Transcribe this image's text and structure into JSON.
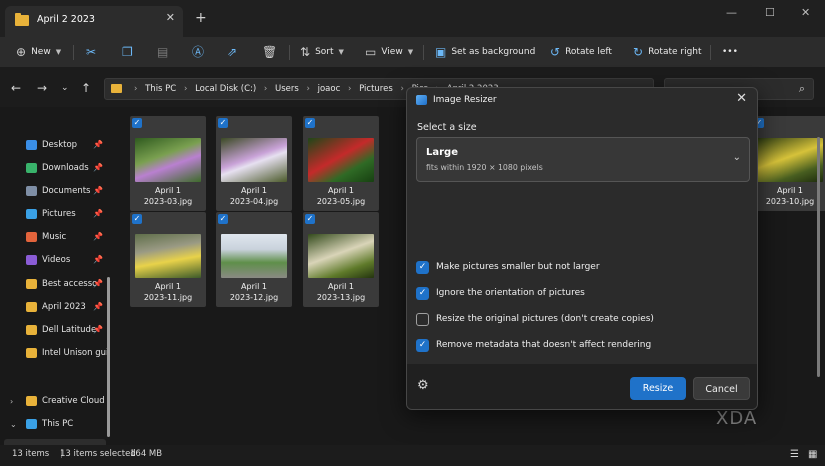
{
  "window": {
    "tab_title": "April 2 2023",
    "new_tab_glyph": "+",
    "minimize_glyph": "—",
    "maximize_glyph": "☐",
    "close_glyph": "✕"
  },
  "toolbar": {
    "new_label": "New",
    "sort_label": "Sort",
    "view_label": "View",
    "set_background_label": "Set as background",
    "rotate_left_label": "Rotate left",
    "rotate_right_label": "Rotate right",
    "more_glyph": "•••"
  },
  "address": {
    "crumbs": [
      "This PC",
      "Local Disk (C:)",
      "Users",
      "joaoc",
      "Pictures",
      "Pics",
      "April 2 2023"
    ]
  },
  "sidebar": {
    "items": [
      {
        "label": "Desktop",
        "icon": "desktop-icon",
        "color": "#3a8ee6",
        "pinned": true
      },
      {
        "label": "Downloads",
        "icon": "download-icon",
        "color": "#39b36b",
        "pinned": true
      },
      {
        "label": "Documents",
        "icon": "document-icon",
        "color": "#7f8fa6",
        "pinned": true
      },
      {
        "label": "Pictures",
        "icon": "pictures-icon",
        "color": "#3aa1e6",
        "pinned": true
      },
      {
        "label": "Music",
        "icon": "music-icon",
        "color": "#e3643c",
        "pinned": true
      },
      {
        "label": "Videos",
        "icon": "videos-icon",
        "color": "#8b5cd6",
        "pinned": true
      },
      {
        "label": "Best accessor",
        "icon": "folder-icon",
        "color": "#e8b23a",
        "pinned": true
      },
      {
        "label": "April 2023",
        "icon": "folder-icon",
        "color": "#e8b23a",
        "pinned": true
      },
      {
        "label": "Dell Latitude",
        "icon": "folder-icon",
        "color": "#e8b23a",
        "pinned": true
      },
      {
        "label": "Intel Unison gui",
        "icon": "folder-icon",
        "color": "#e8b23a",
        "pinned": false
      },
      {
        "label": "Creative Cloud F",
        "icon": "creative-cloud-icon",
        "color": "#e8b23a",
        "pinned": false
      },
      {
        "label": "This PC",
        "icon": "this-pc-icon",
        "color": "#3aa1e6",
        "pinned": false
      }
    ]
  },
  "files": [
    {
      "line1": "April 1",
      "line2": "2023-03.jpg",
      "bg": "linear-gradient(160deg,#2f5a1f 0%,#7aa050 40%,#b980d0 60%,#3d6b2a 100%)"
    },
    {
      "line1": "April 1",
      "line2": "2023-04.jpg",
      "bg": "linear-gradient(160deg,#3b4a24 0%,#c9a3d8 45%,#e6e0f0 55%,#4b5a2a 100%)"
    },
    {
      "line1": "April 1",
      "line2": "2023-05.jpg",
      "bg": "linear-gradient(150deg,#1e4718 0%,#c42a2a 45%,#2f6a25 70%,#174011 100%)"
    },
    {
      "line1": "April 1",
      "line2": "2023-10.jpg",
      "bg": "linear-gradient(160deg,#2a3a12 0%,#d6c23a 45%,#485e20 75%,#1d2b0c 100%)"
    },
    {
      "line1": "April 1",
      "line2": "2023-11.jpg",
      "bg": "linear-gradient(170deg,#5f6e4a 0%,#9a9a84 35%,#e8d24a 60%,#3d5a2a 100%)"
    },
    {
      "line1": "April 1",
      "line2": "2023-12.jpg",
      "bg": "linear-gradient(180deg,#dfe6ee 0%,#c9d2dc 35%,#5f8f4a 65%,#8a8a84 100%)"
    },
    {
      "line1": "April 1",
      "line2": "2023-13.jpg",
      "bg": "linear-gradient(160deg,#334a1c 0%,#d9d4b8 45%,#5f7a2a 75%,#24340f 100%)"
    }
  ],
  "status": {
    "items_count": "13 items",
    "selected": "13 items selected",
    "size": "164 MB"
  },
  "watermark": "XDA",
  "dialog": {
    "title": "Image Resizer",
    "size_label": "Select a size",
    "size_name": "Large",
    "size_desc": "fits within 1920 × 1080 pixels",
    "options": [
      {
        "label": "Make pictures smaller but not larger",
        "checked": true
      },
      {
        "label": "Ignore the orientation of pictures",
        "checked": true
      },
      {
        "label": "Resize the original pictures (don't create copies)",
        "checked": false
      },
      {
        "label": "Remove metadata that doesn't affect rendering",
        "checked": true
      }
    ],
    "resize_label": "Resize",
    "cancel_label": "Cancel"
  }
}
